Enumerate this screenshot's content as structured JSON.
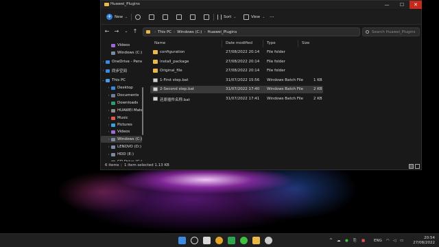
{
  "window": {
    "title": "Huawei_Plugins",
    "controls": {
      "minimize": "—",
      "maximize": "☐",
      "close": "✕"
    }
  },
  "toolbar": {
    "new_label": "New",
    "sort_label": "Sort",
    "view_label": "View",
    "more_label": "···",
    "chevron": "⌄"
  },
  "navigation": {
    "back": "←",
    "forward": "→",
    "recent": "⌄",
    "up": "↑",
    "refresh": "↻"
  },
  "address": {
    "crumbs": [
      "This PC",
      "Windows (C:)",
      "Huawei_Plugins"
    ],
    "separator": "›",
    "dropdown": "⌄"
  },
  "search": {
    "placeholder": "Search Huawei_Plugins"
  },
  "sidebar": {
    "items": [
      {
        "label": "Videos",
        "chev": "",
        "icon_color": "#9b6bd6"
      },
      {
        "label": "Windows (C:)",
        "chev": "",
        "icon_color": "#7a8aa0"
      },
      {
        "label": "OneDrive - Person",
        "chev": "›",
        "icon_color": "#3d8be0"
      },
      {
        "label": "同步空间",
        "chev": "›",
        "icon_color": "#3d8be0"
      },
      {
        "label": "This PC",
        "chev": "⌄",
        "icon_color": "#4a9be8"
      },
      {
        "label": "Desktop",
        "chev": "›",
        "icon_color": "#3a86d8"
      },
      {
        "label": "Documents",
        "chev": "›",
        "icon_color": "#6f7f95"
      },
      {
        "label": "Downloads",
        "chev": "›",
        "icon_color": "#2e9e6e"
      },
      {
        "label": "HUAWEI MatePa",
        "chev": "›",
        "icon_color": "#8c8c8c"
      },
      {
        "label": "Music",
        "chev": "›",
        "icon_color": "#e0584a"
      },
      {
        "label": "Pictures",
        "chev": "›",
        "icon_color": "#3aa0e0"
      },
      {
        "label": "Videos",
        "chev": "›",
        "icon_color": "#9b6bd6"
      },
      {
        "label": "Windows (C:)",
        "chev": "›",
        "icon_color": "#7a8aa0"
      },
      {
        "label": "LENOVO (D:)",
        "chev": "›",
        "icon_color": "#7a8aa0"
      },
      {
        "label": "HDD (E:)",
        "chev": "›",
        "icon_color": "#7a8aa0"
      },
      {
        "label": "CD Drive (G:) Hi",
        "chev": "›",
        "icon_color": "#7a8aa0"
      }
    ]
  },
  "table": {
    "columns": [
      "Name",
      "Date modified",
      "Type",
      "Size"
    ],
    "rows": [
      {
        "name": "configuration",
        "date": "27/08/2022 20:14",
        "type": "File folder",
        "size": "",
        "icon": "folder"
      },
      {
        "name": "install_package",
        "date": "27/08/2022 20:14",
        "type": "File folder",
        "size": "",
        "icon": "folder"
      },
      {
        "name": "Original_file",
        "date": "27/08/2022 20:14",
        "type": "File folder",
        "size": "",
        "icon": "folder"
      },
      {
        "name": "1-First step.bat",
        "date": "31/07/2022 15:56",
        "type": "Windows Batch File",
        "size": "1 KB",
        "icon": "bat"
      },
      {
        "name": "2-Second step.bat",
        "date": "31/07/2022 17:40",
        "type": "Windows Batch File",
        "size": "2 KB",
        "icon": "bat"
      },
      {
        "name": "还原插件名称.bat",
        "date": "31/07/2022 17:41",
        "type": "Windows Batch File",
        "size": "2 KB",
        "icon": "bat"
      }
    ]
  },
  "status": {
    "items_count": "6 items",
    "selected": "1 item selected  1.13 KB",
    "separator": "|"
  },
  "taskbar": {
    "apps": [
      {
        "name": "start",
        "color": "#3d8be0"
      },
      {
        "name": "search",
        "color": "#d8d8d8"
      },
      {
        "name": "task-view",
        "color": "#d8d8d8"
      },
      {
        "name": "chrome",
        "color": "#e5a42b"
      },
      {
        "name": "wechat-green",
        "color": "#2ea44f"
      },
      {
        "name": "wechat",
        "color": "#3fbf3f"
      },
      {
        "name": "file-explorer",
        "color": "#e8b84a"
      },
      {
        "name": "app-circle",
        "color": "#c9c9c9"
      }
    ],
    "tray_language": "ENG",
    "time": "20:54",
    "date": "27/08/2022"
  }
}
